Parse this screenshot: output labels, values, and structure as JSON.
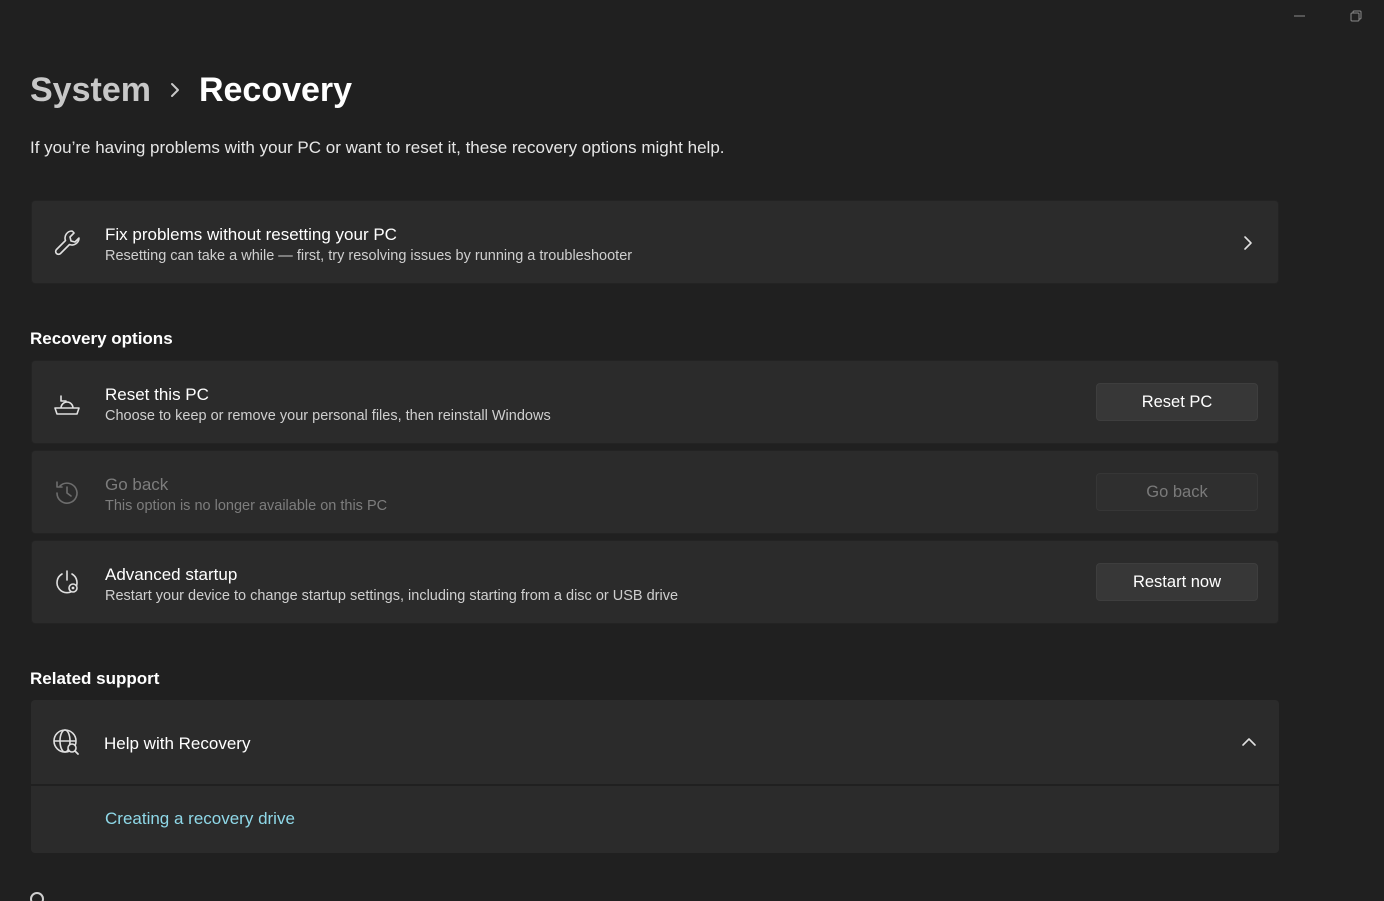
{
  "window": {
    "minimize_icon": "minimize-icon",
    "restore_icon": "restore-icon"
  },
  "breadcrumb": {
    "parent": "System",
    "separator_icon": "chevron-right-icon",
    "current": "Recovery"
  },
  "intro": "If you’re having problems with your PC or want to reset it, these recovery options might help.",
  "fix_card": {
    "icon": "wrench-icon",
    "title": "Fix problems without resetting your PC",
    "subtitle": "Resetting can take a while — first, try resolving issues by running a troubleshooter"
  },
  "recovery_options": {
    "heading": "Recovery options",
    "items": [
      {
        "icon": "reset-pc-icon",
        "title": "Reset this PC",
        "subtitle": "Choose to keep or remove your personal files, then reinstall Windows",
        "button": "Reset PC",
        "enabled": true
      },
      {
        "icon": "history-icon",
        "title": "Go back",
        "subtitle": "This option is no longer available on this PC",
        "button": "Go back",
        "enabled": false
      },
      {
        "icon": "advanced-startup-icon",
        "title": "Advanced startup",
        "subtitle": "Restart your device to change startup settings, including starting from a disc or USB drive",
        "button": "Restart now",
        "enabled": true
      }
    ]
  },
  "related_support": {
    "heading": "Related support",
    "help": {
      "icon": "globe-search-icon",
      "title": "Help with Recovery",
      "expanded": true,
      "links": [
        "Creating a recovery drive"
      ]
    }
  },
  "colors": {
    "background": "#202020",
    "card": "#2b2b2b",
    "link": "#8fd8e8",
    "disabled_text": "#7d7d7d"
  }
}
